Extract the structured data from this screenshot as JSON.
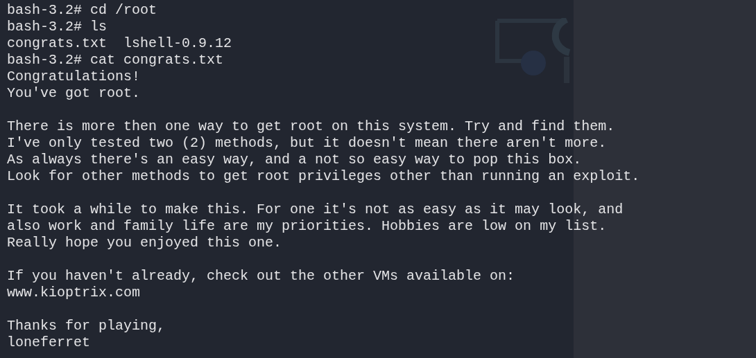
{
  "terminal": {
    "blocks": [
      [
        "bash-3.2# cd /root",
        "bash-3.2# ls",
        "congrats.txt  lshell-0.9.12",
        "bash-3.2# cat congrats.txt",
        "Congratulations!",
        "You've got root."
      ],
      [
        "There is more then one way to get root on this system. Try and find them.",
        "I've only tested two (2) methods, but it doesn't mean there aren't more.",
        "As always there's an easy way, and a not so easy way to pop this box.",
        "Look for other methods to get root privileges other than running an exploit."
      ],
      [
        "It took a while to make this. For one it's not as easy as it may look, and",
        "also work and family life are my priorities. Hobbies are low on my list.",
        "Really hope you enjoyed this one."
      ],
      [
        "If you haven't already, check out the other VMs available on:",
        "www.kioptrix.com"
      ],
      [
        "Thanks for playing,",
        "loneferret"
      ]
    ]
  }
}
